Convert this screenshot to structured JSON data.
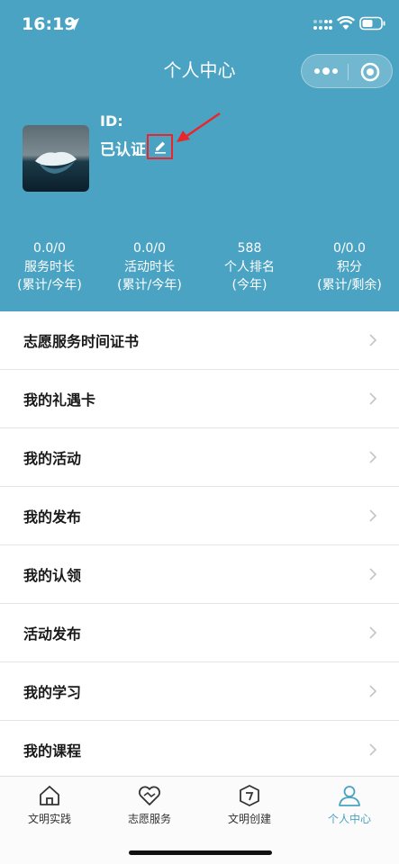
{
  "status_bar": {
    "time": "16:19"
  },
  "nav": {
    "title": "个人中心"
  },
  "profile": {
    "id_label": "ID:",
    "status": "已认证"
  },
  "stats": [
    {
      "value": "0.0/0",
      "label": "服务时长",
      "sub": "(累计/今年)"
    },
    {
      "value": "0.0/0",
      "label": "活动时长",
      "sub": "(累计/今年)"
    },
    {
      "value": "588",
      "label": "个人排名",
      "sub": "(今年)"
    },
    {
      "value": "0/0.0",
      "label": "积分",
      "sub": "(累计/剩余)"
    }
  ],
  "menu": [
    {
      "label": "志愿服务时间证书"
    },
    {
      "label": "我的礼遇卡"
    },
    {
      "label": "我的活动"
    },
    {
      "label": "我的发布"
    },
    {
      "label": "我的认领"
    },
    {
      "label": "活动发布"
    },
    {
      "label": "我的学习"
    },
    {
      "label": "我的课程"
    }
  ],
  "tabs": [
    {
      "label": "文明实践",
      "icon": "home-icon"
    },
    {
      "label": "志愿服务",
      "icon": "heart-hands-icon"
    },
    {
      "label": "文明创建",
      "icon": "cube-icon"
    },
    {
      "label": "个人中心",
      "icon": "person-icon",
      "active": true
    }
  ],
  "colors": {
    "header": "#4aa3c2",
    "accent": "#4aa3c2",
    "highlight": "#e8262b"
  }
}
